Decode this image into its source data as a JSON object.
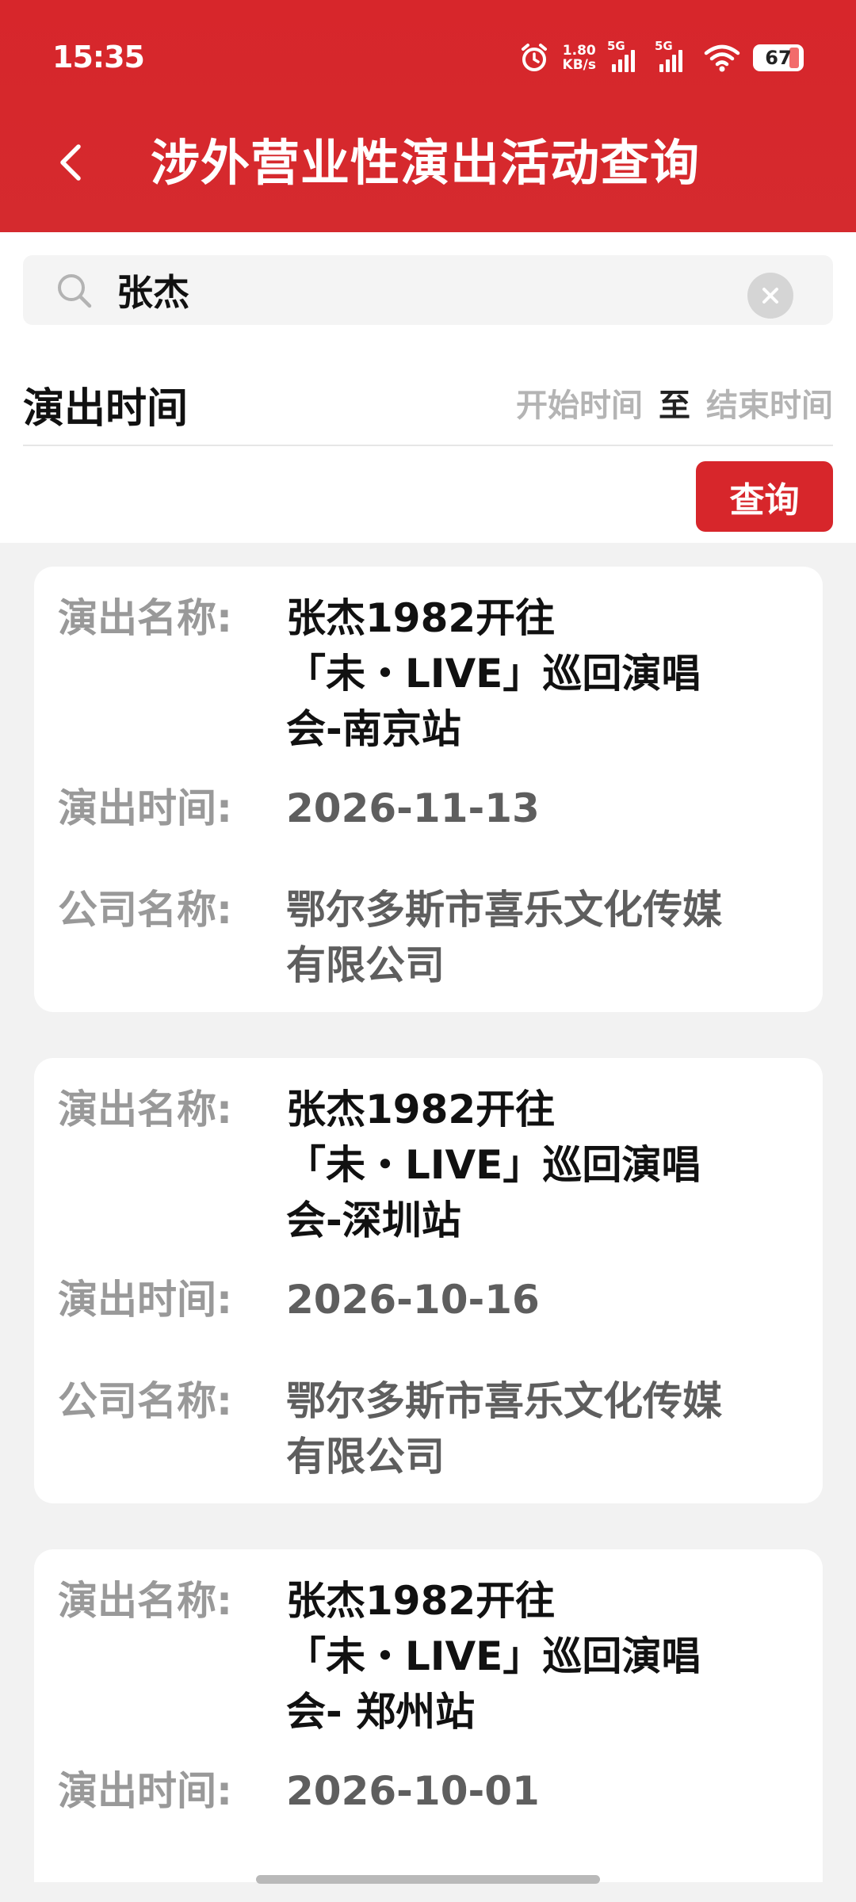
{
  "status_bar": {
    "time": "15:35",
    "net_speed_value": "1.80",
    "net_speed_unit": "KB/s",
    "sim1": "5G",
    "sim2": "5G",
    "battery": "67",
    "icons": [
      "alarm-icon",
      "signal-icon",
      "signal-icon",
      "wifi-icon",
      "battery-icon"
    ]
  },
  "header": {
    "title": "涉外营业性演出活动查询",
    "back_icon": "chevron-left-icon"
  },
  "search": {
    "value": "张杰",
    "placeholder": ""
  },
  "filter": {
    "time_label": "演出时间",
    "start_placeholder": "开始时间",
    "to": "至",
    "end_placeholder": "结束时间",
    "query_button": "查询"
  },
  "labels": {
    "name": "演出名称:",
    "date": "演出时间:",
    "company": "公司名称:"
  },
  "results": [
    {
      "name": "张杰1982开往「未・LIVE」巡回演唱会-南京站",
      "name_lines": [
        "张杰1982开往",
        "「未・LIVE」巡回演唱",
        "会-南京站"
      ],
      "date": "2026-11-13",
      "company_lines": [
        "鄂尔多斯市喜乐文化传媒",
        "有限公司"
      ]
    },
    {
      "name": "张杰1982开往「未・LIVE」巡回演唱会-深圳站",
      "name_lines": [
        "张杰1982开往",
        "「未・LIVE」巡回演唱",
        "会-深圳站"
      ],
      "date": "2026-10-16",
      "company_lines": [
        "鄂尔多斯市喜乐文化传媒",
        "有限公司"
      ]
    },
    {
      "name": "张杰1982开往「未・LIVE」巡回演唱会- 郑州站",
      "name_lines": [
        "张杰1982开往",
        "「未・LIVE」巡回演唱",
        "会- 郑州站"
      ],
      "date": "2026-10-01"
    }
  ],
  "colors": {
    "brand_red": "#d7262b",
    "label_gray": "#999999",
    "value_dark": "#111111",
    "value_gray": "#5e5e5e",
    "background": "#f2f2f2"
  }
}
